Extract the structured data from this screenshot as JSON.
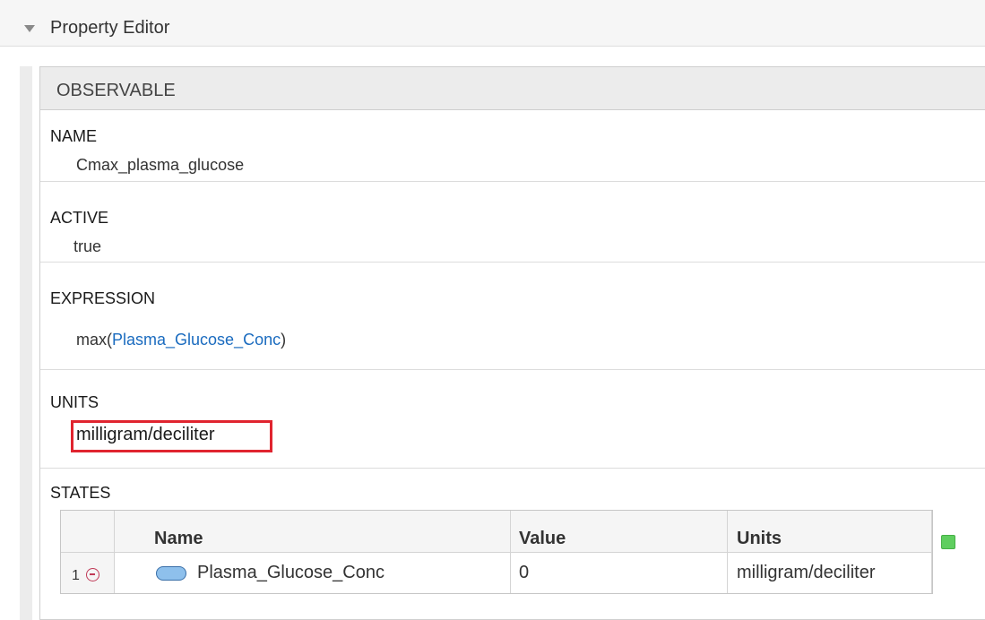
{
  "header": {
    "title": "Property Editor",
    "collapse_icon": "triangle-down-icon"
  },
  "panel": {
    "title": "OBSERVABLE",
    "name": {
      "label": "NAME",
      "value": "Cmax_plasma_glucose"
    },
    "active": {
      "label": "ACTIVE",
      "value": "true"
    },
    "expression": {
      "label": "EXPRESSION",
      "func": "max(",
      "variable": "Plasma_Glucose_Conc",
      "close": ")"
    },
    "units": {
      "label": "UNITS",
      "value": "milligram/deciliter",
      "highlight_color": "#e0242f"
    },
    "states": {
      "label": "STATES",
      "columns": [
        "Name",
        "Value",
        "Units"
      ],
      "rows": [
        {
          "index": "1",
          "name": "Plasma_Glucose_Conc",
          "value": "0",
          "units": "milligram/deciliter"
        }
      ]
    }
  },
  "colors": {
    "link": "#1a6bbf",
    "status_indicator": "#5fce5f"
  }
}
